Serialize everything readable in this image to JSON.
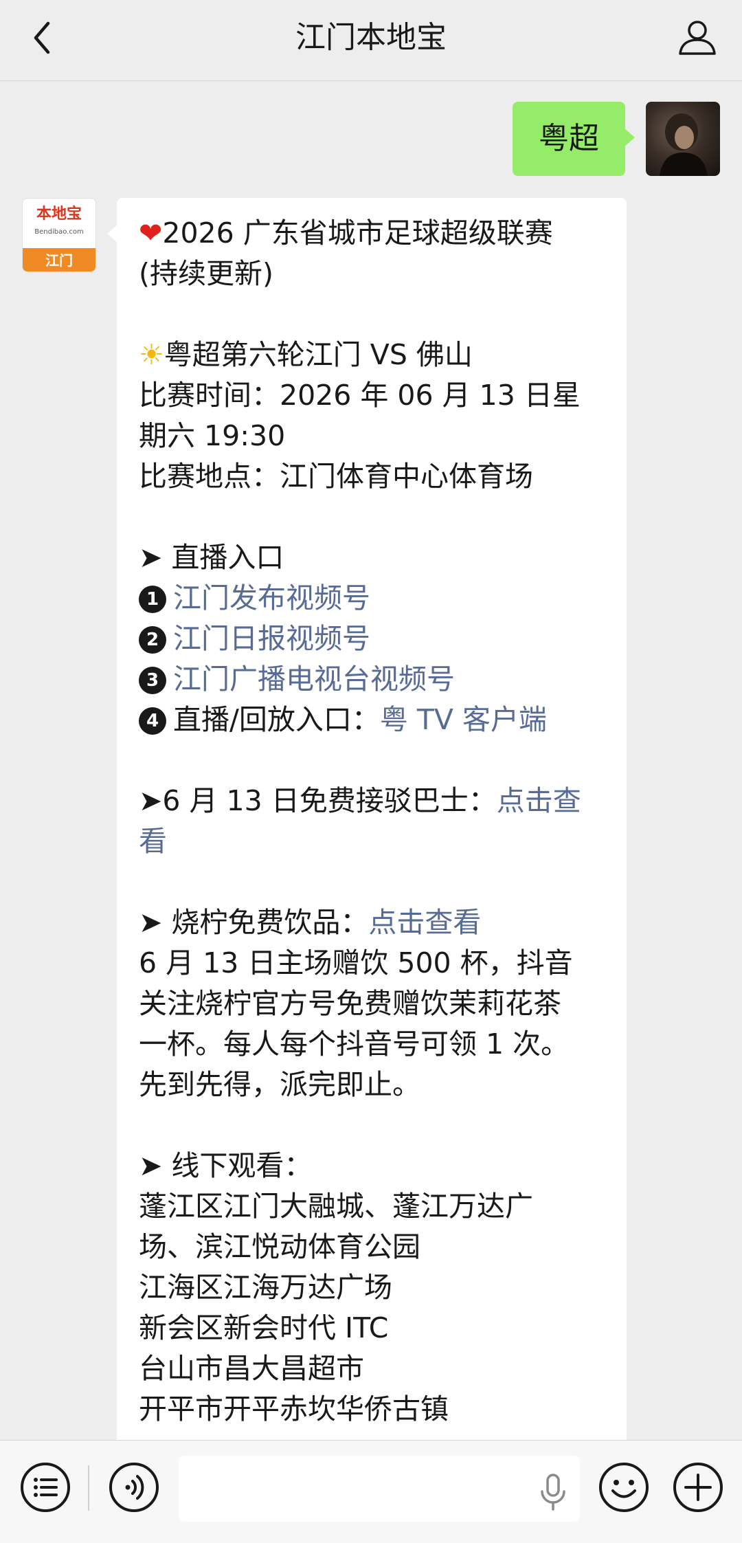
{
  "header": {
    "title": "江门本地宝",
    "back_icon": "chevron-left-icon",
    "profile_icon": "user-profile-icon"
  },
  "outgoing": {
    "text": "粤超"
  },
  "avatar_brand": {
    "top": "本地宝",
    "domain": "Bendibao.com",
    "bottom": "江门"
  },
  "message": {
    "title_line1": "2026 广东省城市足球超级联赛",
    "title_line2": "(持续更新)",
    "match_title": "粤超第六轮江门 VS 佛山",
    "time_line1": "比赛时间：2026 年 06 月 13 日星",
    "time_line2": "期六 19:30",
    "venue": "比赛地点：江门体育中心体育场",
    "live_heading": "➤ 直播入口",
    "live_items": [
      {
        "num": "1",
        "text": "江门发布视频号"
      },
      {
        "num": "2",
        "text": "江门日报视频号"
      },
      {
        "num": "3",
        "text": "江门广播电视台视频号"
      }
    ],
    "live_item4_num": "4",
    "live_item4_label": "直播/回放入口：",
    "live_item4_link": "粤 TV 客户端",
    "bus_label": "➤6 月 13 日免费接驳巴士：",
    "bus_link_line1": "点击查",
    "bus_link_line2": "看",
    "drinks_label": "➤ 烧柠免费饮品：",
    "drinks_link": "点击查看",
    "drinks_lines": [
      "6 月 13 日主场赠饮 500 杯，抖音",
      "关注烧柠官方号免费赠饮茉莉花茶",
      "一杯。每人每个抖音号可领 1 次。",
      "先到先得，派完即止。"
    ],
    "offline_heading": "➤ 线下观看：",
    "offline_lines": [
      "蓬江区江门大融城、蓬江万达广",
      "场、滨江悦动体育公园",
      "江海区江海万达广场",
      "新会区新会时代 ITC",
      "台山市昌大昌超市",
      "开平市开平赤坎华侨古镇"
    ]
  },
  "inputbar": {
    "icons": [
      "list-menu-icon",
      "voice-icon",
      "microphone-icon",
      "emoji-icon",
      "plus-icon"
    ],
    "text": ""
  }
}
